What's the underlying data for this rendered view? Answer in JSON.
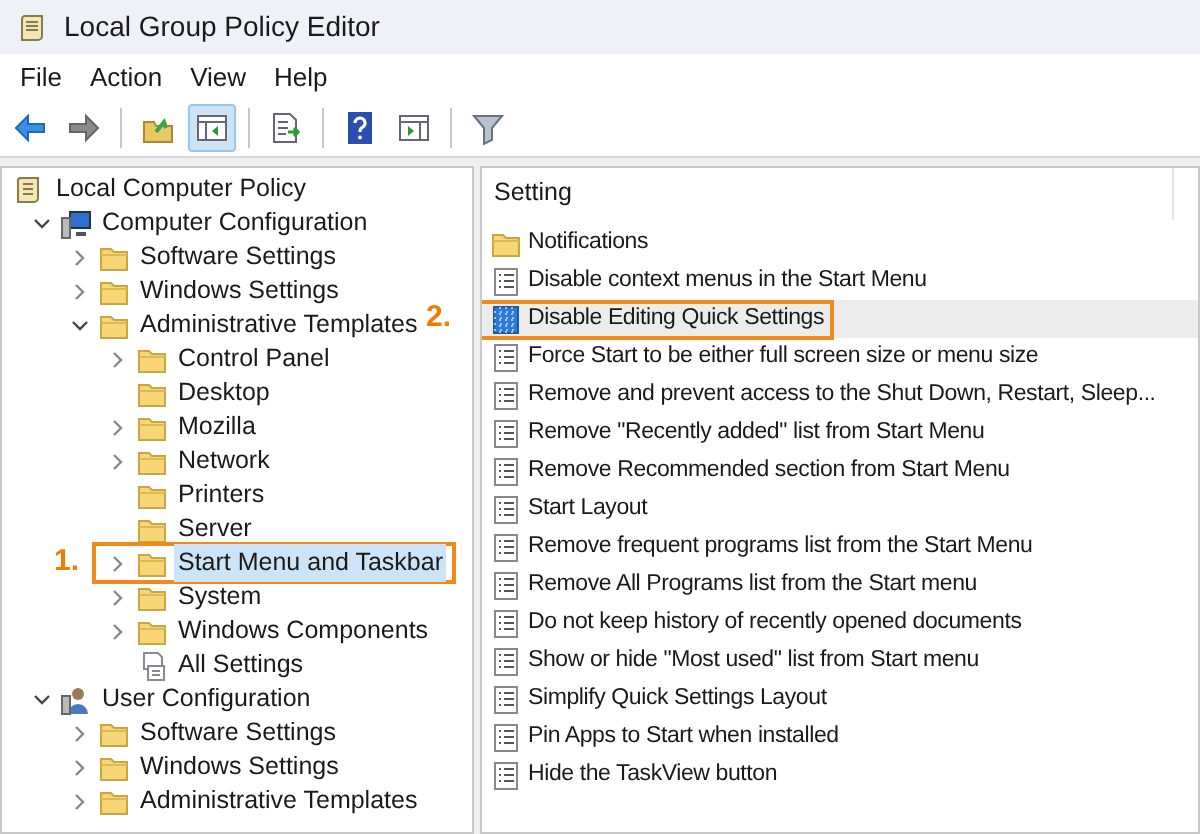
{
  "window": {
    "title": "Local Group Policy Editor"
  },
  "menu": [
    "File",
    "Action",
    "View",
    "Help"
  ],
  "toolbar": [
    {
      "kind": "back",
      "pressed": false
    },
    {
      "kind": "forward",
      "pressed": false
    },
    {
      "kind": "separator"
    },
    {
      "kind": "up",
      "pressed": false
    },
    {
      "kind": "tree",
      "pressed": true
    },
    {
      "kind": "separator"
    },
    {
      "kind": "export",
      "pressed": false
    },
    {
      "kind": "separator"
    },
    {
      "kind": "help",
      "pressed": false
    },
    {
      "kind": "pane",
      "pressed": false
    },
    {
      "kind": "separator"
    },
    {
      "kind": "filter",
      "pressed": false
    }
  ],
  "tree": {
    "label": "Local Computer Policy",
    "kind": "policy",
    "children": [
      {
        "label": "Computer Configuration",
        "kind": "computer",
        "expanded": true,
        "children": [
          {
            "label": "Software Settings",
            "kind": "folder",
            "expanded": false,
            "selected": false
          },
          {
            "label": "Windows Settings",
            "kind": "folder",
            "expanded": false,
            "selected": false
          },
          {
            "label": "Administrative Templates",
            "kind": "folder",
            "expanded": true,
            "selected": false,
            "children": [
              {
                "label": "Control Panel",
                "kind": "folder",
                "expanded": false,
                "selected": false
              },
              {
                "label": "Desktop",
                "kind": "folder",
                "selected": false
              },
              {
                "label": "Mozilla",
                "kind": "folder",
                "expanded": false,
                "selected": false
              },
              {
                "label": "Network",
                "kind": "folder",
                "expanded": false,
                "selected": false
              },
              {
                "label": "Printers",
                "kind": "folder",
                "selected": false
              },
              {
                "label": "Server",
                "kind": "folder",
                "selected": false
              },
              {
                "label": "Start Menu and Taskbar",
                "kind": "folder",
                "expanded": false,
                "selected": true,
                "annotation": "1."
              },
              {
                "label": "System",
                "kind": "folder",
                "expanded": false,
                "selected": false
              },
              {
                "label": "Windows Components",
                "kind": "folder",
                "expanded": false,
                "selected": false
              },
              {
                "label": "All Settings",
                "kind": "allsettings",
                "selected": false
              }
            ]
          }
        ]
      },
      {
        "label": "User Configuration",
        "kind": "user",
        "expanded": true,
        "children": [
          {
            "label": "Software Settings",
            "kind": "folder",
            "expanded": false,
            "selected": false
          },
          {
            "label": "Windows Settings",
            "kind": "folder",
            "expanded": false,
            "selected": false
          },
          {
            "label": "Administrative Templates",
            "kind": "folder",
            "expanded": false,
            "selected": false
          }
        ]
      }
    ]
  },
  "settings": {
    "column": "Setting",
    "rows": [
      {
        "label": "Notifications",
        "kind": "folder",
        "selected": false
      },
      {
        "label": "Disable context menus in the Start Menu",
        "kind": "policy",
        "selected": false
      },
      {
        "label": "Disable Editing Quick Settings",
        "kind": "policy-active",
        "selected": true,
        "annotation": "2."
      },
      {
        "label": "Force Start to be either full screen size or menu size",
        "kind": "policy",
        "selected": false
      },
      {
        "label": "Remove and prevent access to the Shut Down, Restart, Sleep...",
        "kind": "policy",
        "selected": false
      },
      {
        "label": "Remove \"Recently added\" list from Start Menu",
        "kind": "policy",
        "selected": false
      },
      {
        "label": "Remove Recommended section from Start Menu",
        "kind": "policy",
        "selected": false
      },
      {
        "label": "Start Layout",
        "kind": "policy",
        "selected": false
      },
      {
        "label": "Remove frequent programs list from the Start Menu",
        "kind": "policy",
        "selected": false
      },
      {
        "label": "Remove All Programs list from the Start menu",
        "kind": "policy",
        "selected": false
      },
      {
        "label": "Do not keep history of recently opened documents",
        "kind": "policy",
        "selected": false
      },
      {
        "label": "Show or hide \"Most used\" list from Start menu",
        "kind": "policy",
        "selected": false
      },
      {
        "label": "Simplify Quick Settings Layout",
        "kind": "policy",
        "selected": false
      },
      {
        "label": "Pin Apps to Start when installed",
        "kind": "policy",
        "selected": false
      },
      {
        "label": "Hide the TaskView button",
        "kind": "policy",
        "selected": false
      }
    ]
  }
}
